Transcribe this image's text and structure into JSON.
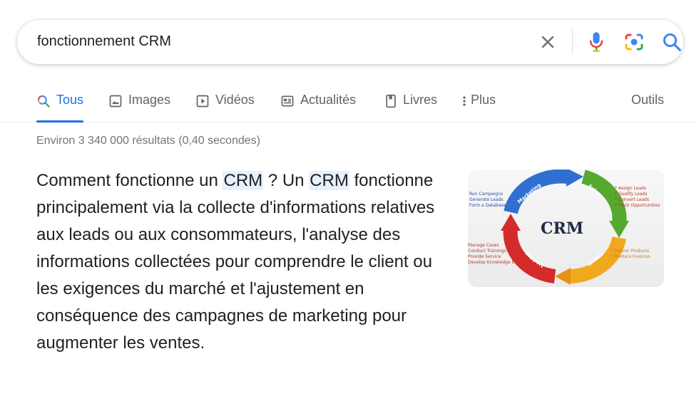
{
  "search": {
    "query": "fonctionnement CRM"
  },
  "tabs": [
    {
      "label": "Tous",
      "icon": "search-icon",
      "active": true
    },
    {
      "label": "Images",
      "icon": "image-icon"
    },
    {
      "label": "Vidéos",
      "icon": "video-icon"
    },
    {
      "label": "Actualités",
      "icon": "news-icon"
    },
    {
      "label": "Livres",
      "icon": "book-icon"
    },
    {
      "label": "Plus",
      "icon": "more-vert-icon"
    }
  ],
  "tools_label": "Outils",
  "result_stats": "Environ 3 340 000 résultats (0,40 secondes)",
  "snippet": {
    "part1": "Comment fonctionne un ",
    "hl1": "CRM",
    "part2": " ? Un ",
    "hl2": "CRM",
    "part3": " fonctionne principalement via la collecte d'informations relatives aux leads ou aux consommateurs, l'analyse des informations collectées pour comprendre le client ou les exigences du marché et l'ajustement en conséquence des campagnes de marketing pour augmenter les ventes."
  },
  "diagram": {
    "center": "CRM",
    "arc_labels": [
      "Marketing",
      "Sales",
      "Orders",
      "Support"
    ],
    "left_top": [
      "Run Campaigns",
      "Generate Leads",
      "Form a Database"
    ],
    "right_top": [
      "* Assign Leads",
      "* Qualify Leads",
      "* Convert Leads",
      "* Track Opportunities"
    ],
    "left_bottom": [
      "Manage Cases",
      "Conduct Trainings",
      "Provide Service",
      "Develop Knowledge base"
    ],
    "right_bottom": [
      "* Deliver Products",
      "* Produce Invoices"
    ]
  },
  "colors": {
    "accent": "#1a73e8",
    "highlight": "#e8f0fe",
    "muted": "#70757a"
  }
}
